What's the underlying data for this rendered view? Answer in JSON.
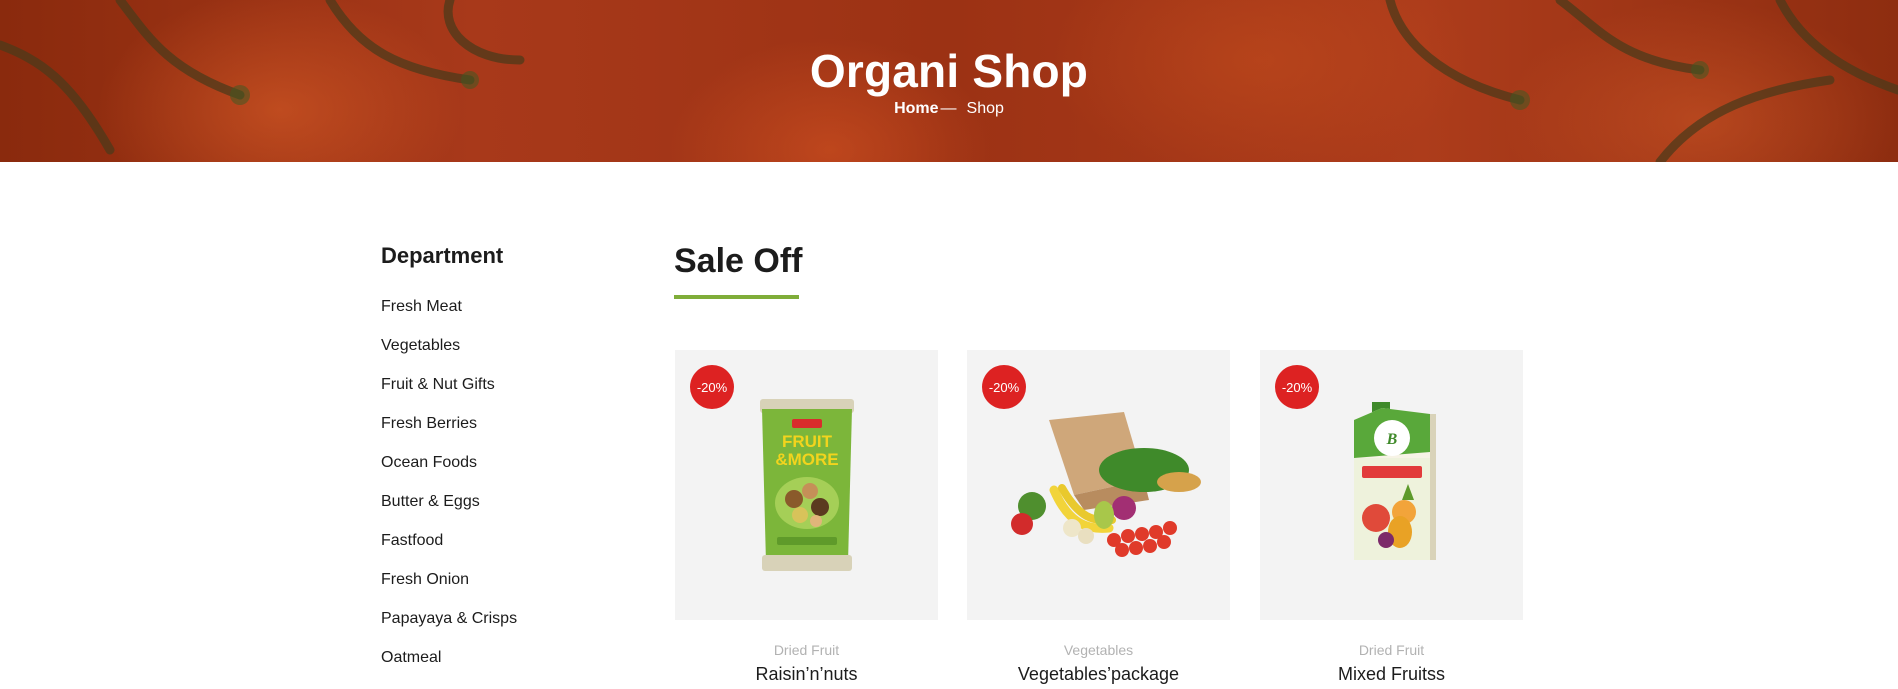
{
  "hero": {
    "title": "Organi Shop",
    "breadcrumb": {
      "home": "Home",
      "separator": "—",
      "current": "Shop"
    }
  },
  "sidebar": {
    "heading": "Department",
    "items": [
      {
        "label": "Fresh Meat"
      },
      {
        "label": "Vegetables"
      },
      {
        "label": "Fruit & Nut Gifts"
      },
      {
        "label": "Fresh Berries"
      },
      {
        "label": "Ocean Foods"
      },
      {
        "label": "Butter & Eggs"
      },
      {
        "label": "Fastfood"
      },
      {
        "label": "Fresh Onion"
      },
      {
        "label": "Papayaya & Crisps"
      },
      {
        "label": "Oatmeal"
      }
    ]
  },
  "sale": {
    "title": "Sale Off",
    "accent_color": "#7fad39",
    "products": [
      {
        "badge": "-20%",
        "category": "Dried Fruit",
        "name": "Raisin’n’nuts",
        "image": "fruit-and-more-snack-pack"
      },
      {
        "badge": "-20%",
        "category": "Vegetables",
        "name": "Vegetables’package",
        "image": "paper-bag-with-vegetables"
      },
      {
        "badge": "-20%",
        "category": "Dried Fruit",
        "name": "Mixed Fruitss",
        "image": "mixed-fruit-juice-carton"
      }
    ]
  },
  "colors": {
    "badge": "#dd2222",
    "text": "#1c1c1c",
    "muted": "#b2b2b2"
  }
}
